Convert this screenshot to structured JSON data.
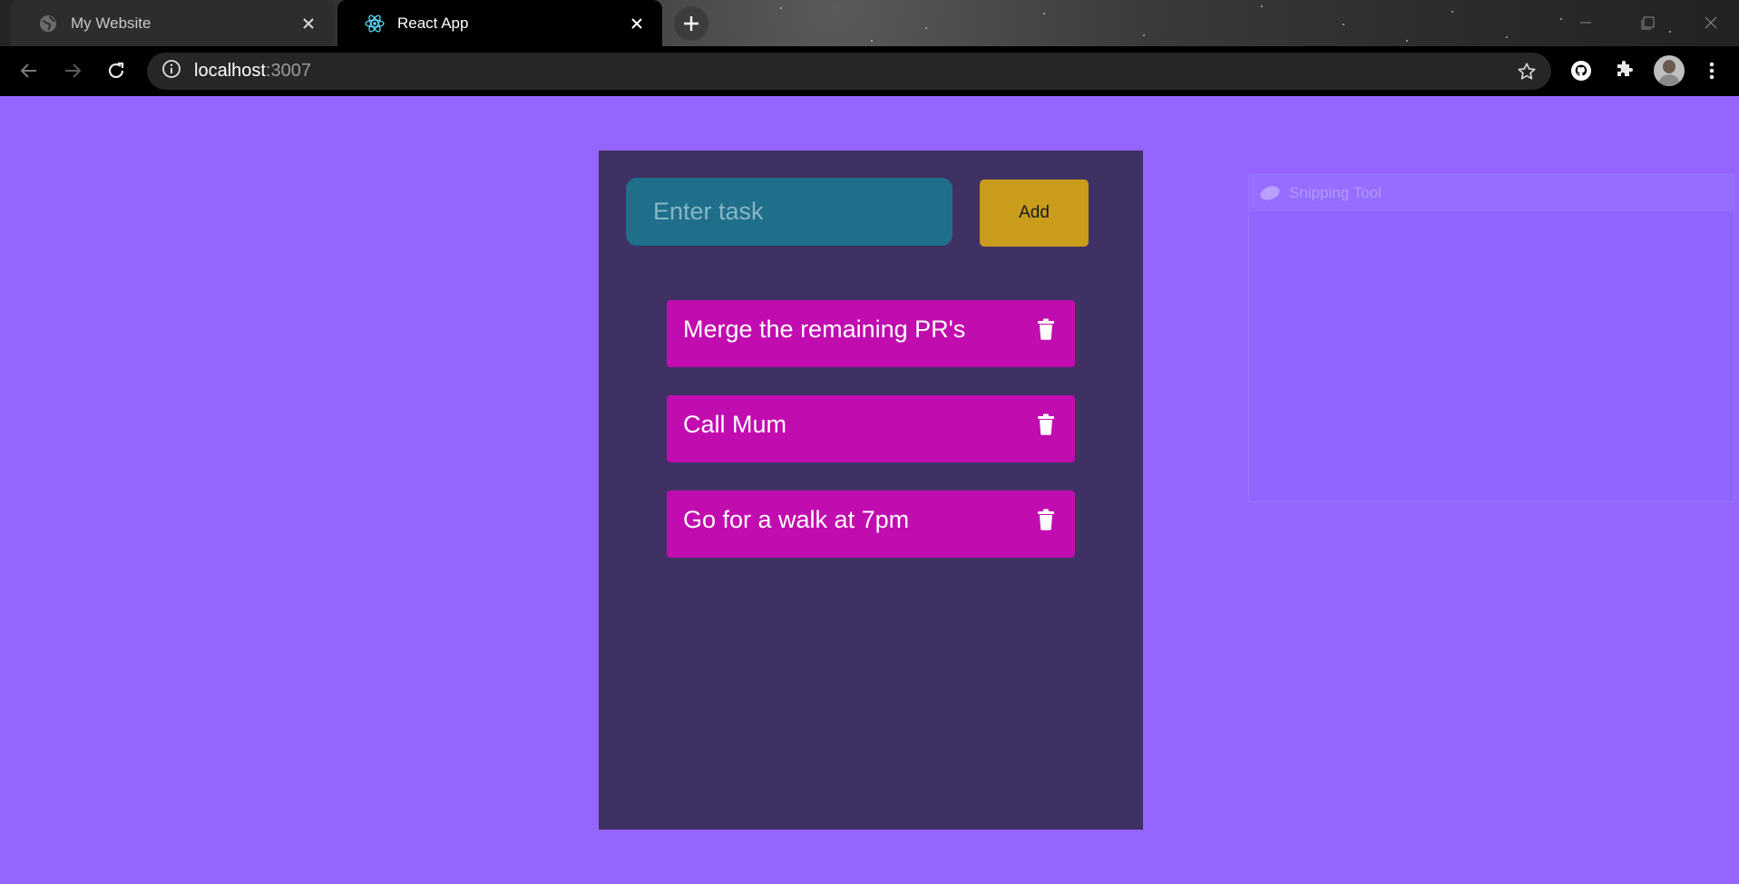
{
  "browser": {
    "tabs": [
      {
        "title": "My Website",
        "icon": "globe-icon",
        "active": false
      },
      {
        "title": "React App",
        "icon": "react-icon",
        "active": true
      }
    ],
    "address": {
      "host": "localhost",
      "port": ":3007"
    },
    "icons": [
      "back-icon",
      "forward-icon",
      "reload-icon",
      "info-icon",
      "bookmark-star-icon",
      "github-icon",
      "extensions-icon",
      "avatar",
      "menu-icon"
    ]
  },
  "snipping_tool": {
    "title": "Snipping Tool"
  },
  "app": {
    "input_placeholder": "Enter task",
    "input_value": "",
    "add_label": "Add",
    "tasks": [
      {
        "text": "Merge the remaining PR's"
      },
      {
        "text": "Call Mum"
      },
      {
        "text": "Go for a walk at 7pm"
      }
    ]
  },
  "colors": {
    "page_bg": "#9466ff",
    "card_bg": "#3f3164",
    "input_bg": "#1f6e8a",
    "add_button_bg": "#c99c1c",
    "task_bg": "#c10cb0"
  }
}
